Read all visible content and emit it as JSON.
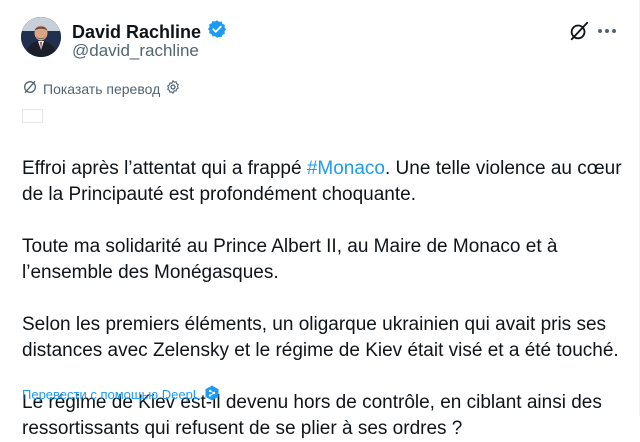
{
  "author": {
    "name": "David Rachline",
    "handle": "@david_rachline",
    "verified": true
  },
  "translate": {
    "label": "Показать перевод"
  },
  "tweet": {
    "p1_before": "Effroi après l’attentat qui a frappé ",
    "p1_hashtag": "#Monaco",
    "p1_after": ". Une telle violence au cœur de la Principauté est profondément choquante.",
    "p2": "Toute ma solidarité au Prince Albert II, au Maire de Monaco et à l’ensemble des Monégasques.",
    "p3": "Selon les premiers éléments, un oligarque ukrainien qui avait pris ses distances avec Zelensky et le régime de Kiev était visé et a été touché.",
    "p4": "Le régime de Kiev est-il devenu hors de contrôle, en ciblant ainsi des ressortissants qui refusent de se plier à ses ordres ?"
  },
  "deepl": {
    "label": "Перевести с помощью DeepL"
  },
  "colors": {
    "accent": "#1d9bf0",
    "secondary_text": "#536471",
    "primary_text": "#0f1419"
  },
  "icons": [
    "verified-badge-icon",
    "grok-icon",
    "more-icon",
    "translate-icon",
    "settings-icon",
    "monaco-flag-icon",
    "deepl-icon"
  ]
}
